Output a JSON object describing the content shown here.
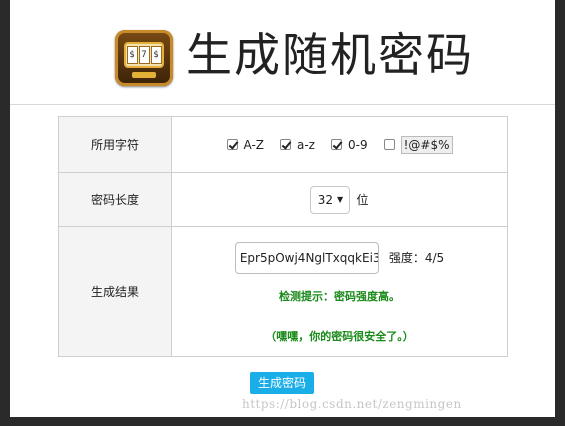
{
  "title": "生成随机密码",
  "logo": {
    "reels": [
      "$",
      "7",
      "$"
    ],
    "icon": "slot-machine-icon"
  },
  "rows": {
    "charset_label": "所用字符",
    "charset_options": [
      {
        "label": "A-Z",
        "checked": true
      },
      {
        "label": "a-z",
        "checked": true
      },
      {
        "label": "0-9",
        "checked": true
      },
      {
        "label": "!@#$%",
        "checked": false
      }
    ],
    "length_label": "密码长度",
    "length_value": "32",
    "length_unit": "位",
    "result_label": "生成结果",
    "password": "Epr5pOwj4NglTxqqkEi3",
    "strength_text": "强度：4/5",
    "hint": "检测提示：密码强度高。",
    "safety": "（嘿嘿，你的密码很安全了。）"
  },
  "button_label": "生成密码",
  "watermark": "https://blog.csdn.net/zengmingen"
}
